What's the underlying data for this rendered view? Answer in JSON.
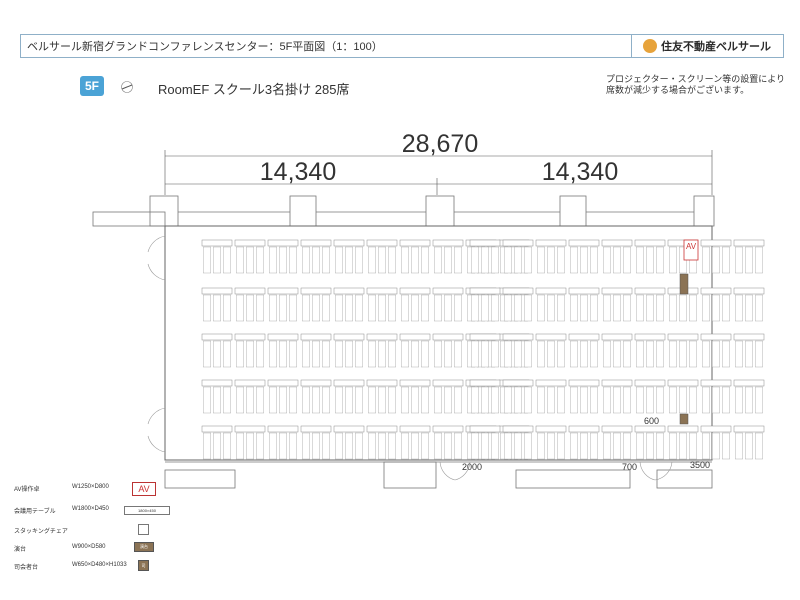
{
  "header": {
    "title": "ベルサール新宿グランドコンファレンスセンター：5F平面図（1：100）",
    "logo_text": "住友不動産ベルサール"
  },
  "floor_badge": "5F",
  "room_title": "RoomEF スクール3名掛け 285席",
  "note": {
    "line1": "プロジェクター・スクリーン等の設置により",
    "line2": "席数が減少する場合がございます。"
  },
  "dimensions": {
    "total": "28,670",
    "left": "14,340",
    "right": "14,340",
    "label_600": "600",
    "label_2000": "2000",
    "label_700": "700",
    "label_3500": "3500"
  },
  "av_label": "AV",
  "seating": {
    "rows": 5,
    "left_tables_per_row": 10,
    "right_tables_per_row": 9,
    "seats_per_table": 3
  },
  "legend": {
    "items": [
      {
        "name": "AV操作卓",
        "dim": "W1250×D800",
        "sample": "AV"
      },
      {
        "name": "会議用テーブル",
        "dim": "W1800×D450",
        "sample": "1800×450"
      },
      {
        "name": "スタッキングチェア",
        "dim": "",
        "sample": ""
      },
      {
        "name": "演台",
        "dim": "W900×D580",
        "sample": "演台"
      },
      {
        "name": "司会者台",
        "dim": "W650×D480×H1033",
        "sample": "司"
      }
    ]
  },
  "colors": {
    "accent": "#4ba3d6",
    "av_red": "#cc3333",
    "furniture_brown": "#8b7355",
    "border_blue": "#8fb0c8"
  }
}
